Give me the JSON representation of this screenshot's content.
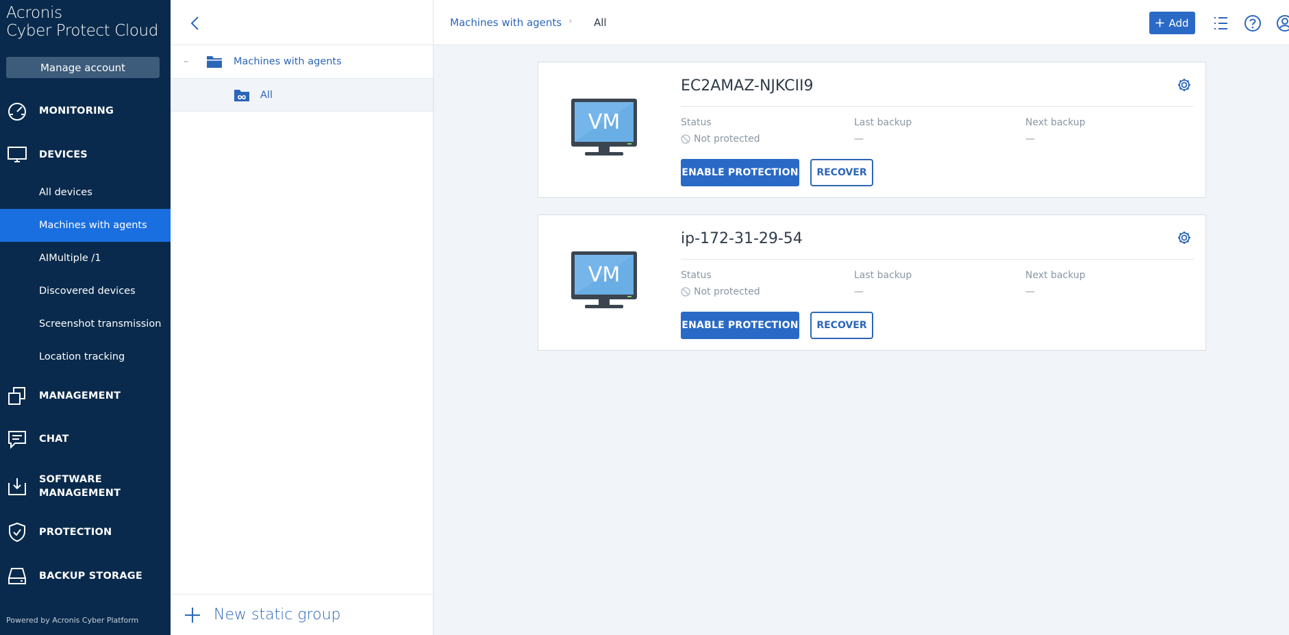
{
  "sidebar": {
    "brand_line1": "Acronis",
    "brand_line2": "Cyber Protect Cloud",
    "manage_account": "Manage account",
    "sections": {
      "monitoring": "MONITORING",
      "devices": "DEVICES",
      "management": "MANAGEMENT",
      "chat": "CHAT",
      "software_management_1": "SOFTWARE",
      "software_management_2": "MANAGEMENT",
      "protection": "PROTECTION",
      "backup_storage": "BACKUP STORAGE"
    },
    "device_items": [
      "All devices",
      "Machines with agents",
      "AIMultiple /1",
      "Discovered devices",
      "Screenshot transmission",
      "Location tracking"
    ],
    "active_item": "Machines with agents",
    "powered_by": "Powered by Acronis Cyber Platform"
  },
  "tree": {
    "collapse_symbol": "–",
    "root_label": "Machines with agents",
    "child_label": "All",
    "new_group_label": "New static group"
  },
  "header": {
    "breadcrumb_parent": "Machines with agents",
    "breadcrumb_sep": "›",
    "breadcrumb_current": "All",
    "add_label": "Add"
  },
  "cards": [
    {
      "title": "EC2AMAZ-NJKCII9",
      "icon_text": "VM",
      "status_label": "Status",
      "status_value": "Not protected",
      "last_backup_label": "Last backup",
      "last_backup_value": "—",
      "next_backup_label": "Next backup",
      "next_backup_value": "—",
      "enable_label": "ENABLE PROTECTION",
      "recover_label": "RECOVER"
    },
    {
      "title": "ip-172-31-29-54",
      "icon_text": "VM",
      "status_label": "Status",
      "status_value": "Not protected",
      "last_backup_label": "Last backup",
      "last_backup_value": "—",
      "next_backup_label": "Next backup",
      "next_backup_value": "—",
      "enable_label": "ENABLE PROTECTION",
      "recover_label": "RECOVER"
    }
  ],
  "colors": {
    "sidebar_bg": "#092a4c",
    "active_nav": "#1a6fe0",
    "primary": "#2a6ac6",
    "link": "#2c66b8"
  }
}
